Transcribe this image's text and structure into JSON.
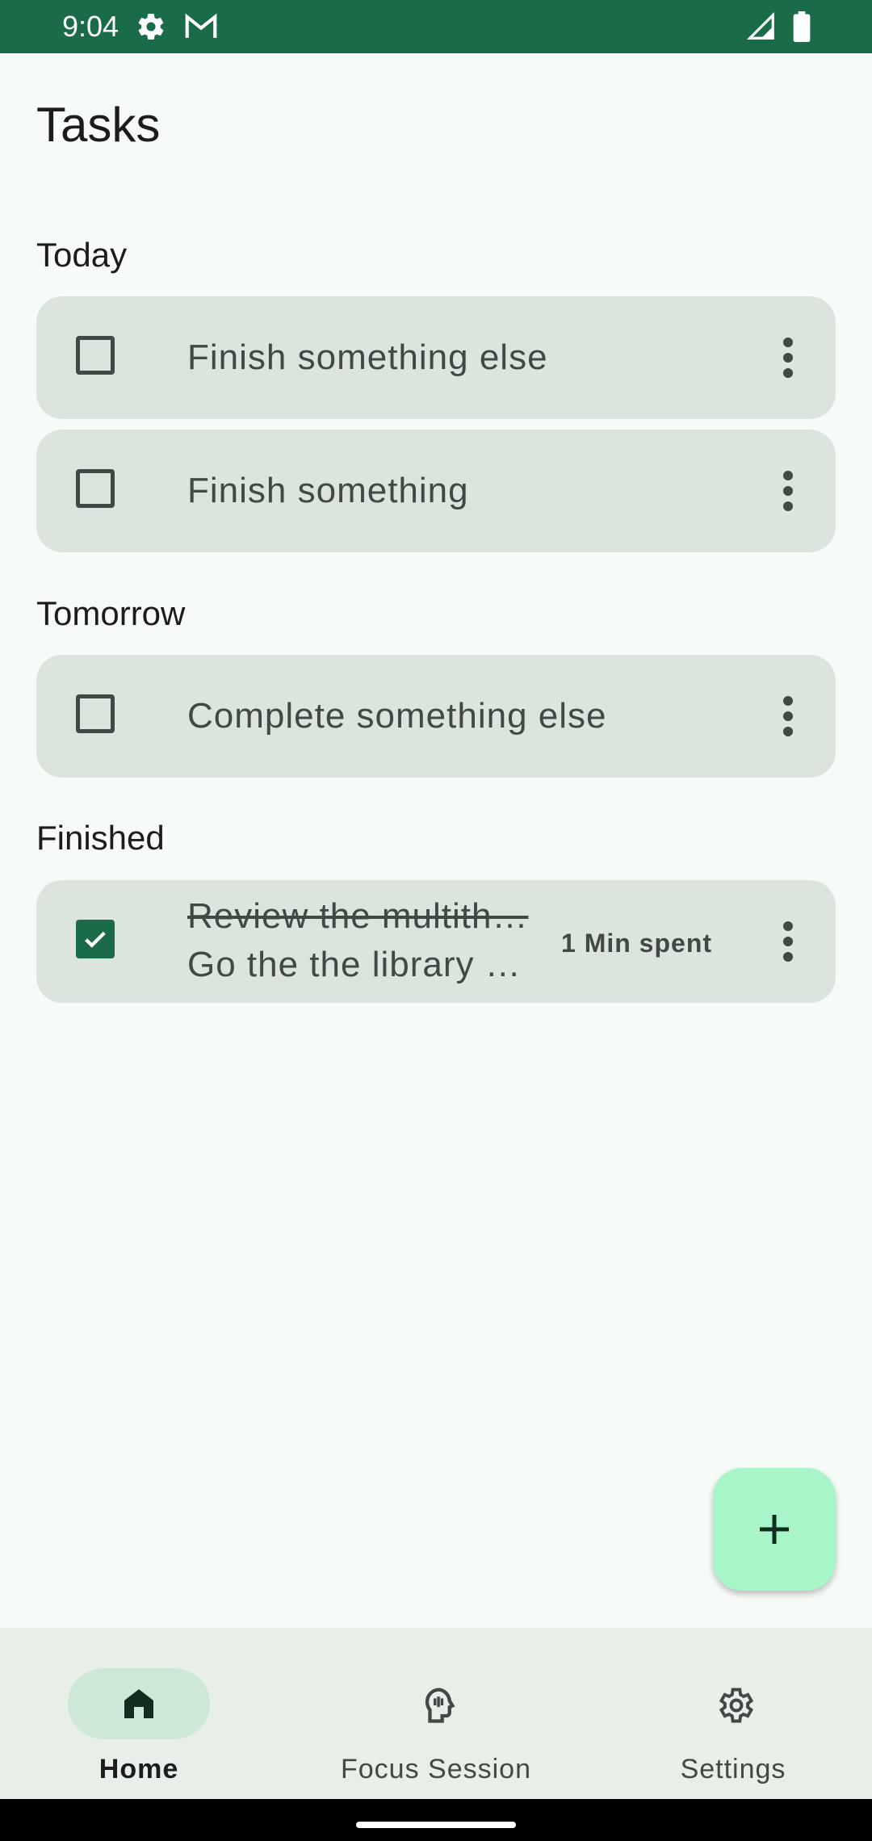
{
  "status_bar": {
    "time": "9:04",
    "icons": [
      "gear-icon",
      "gmail-icon",
      "signal-icon",
      "battery-icon"
    ]
  },
  "page": {
    "title": "Tasks"
  },
  "sections": [
    {
      "label": "Today",
      "tasks": [
        {
          "title": "Finish something else",
          "checked": false
        },
        {
          "title": "Finish something",
          "checked": false
        }
      ]
    },
    {
      "label": "Tomorrow",
      "tasks": [
        {
          "title": "Complete something else",
          "checked": false
        }
      ]
    },
    {
      "label": "Finished",
      "tasks": [
        {
          "title": "Review the multith…",
          "subtitle": "Go the the library …",
          "time_spent": "1 Min spent",
          "checked": true
        }
      ]
    }
  ],
  "fab": {
    "icon": "add-icon"
  },
  "nav": {
    "items": [
      {
        "label": "Home",
        "icon": "home-icon",
        "active": true
      },
      {
        "label": "Focus Session",
        "icon": "focus-head-icon",
        "active": false
      },
      {
        "label": "Settings",
        "icon": "settings-gear-icon",
        "active": false
      }
    ]
  },
  "colors": {
    "primary": "#1A6B48",
    "card": "#DCE5DD",
    "fab": "#A7F5C8",
    "background": "#F7FBF7"
  }
}
